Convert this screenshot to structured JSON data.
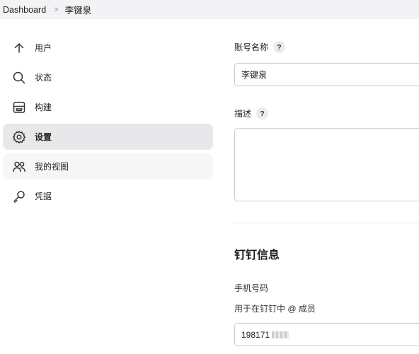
{
  "breadcrumb": {
    "root": "Dashboard",
    "separator": ">",
    "current": "李键泉"
  },
  "sidebar": {
    "items": [
      {
        "label": "用户",
        "icon": "arrow-up-icon",
        "state": "normal"
      },
      {
        "label": "状态",
        "icon": "search-icon",
        "state": "normal"
      },
      {
        "label": "构建",
        "icon": "inbox-tray-icon",
        "state": "normal"
      },
      {
        "label": "设置",
        "icon": "gear-icon",
        "state": "active"
      },
      {
        "label": "我的视图",
        "icon": "people-icon",
        "state": "hover"
      },
      {
        "label": "凭据",
        "icon": "key-icon",
        "state": "normal"
      }
    ]
  },
  "form": {
    "account_name": {
      "label": "账号名称",
      "help": "?",
      "value": "李键泉"
    },
    "description": {
      "label": "描述",
      "help": "?",
      "value": ""
    },
    "dingtalk_section": {
      "title": "钉钉信息",
      "phone_label": "手机号码",
      "phone_hint": "用于在钉钉中 @ 成员",
      "phone_value": "198171"
    }
  },
  "colors": {
    "active_item_bg": "#e8e8ea",
    "breadcrumb_bg": "#f3f3f5",
    "input_border": "#c9c9ce"
  }
}
